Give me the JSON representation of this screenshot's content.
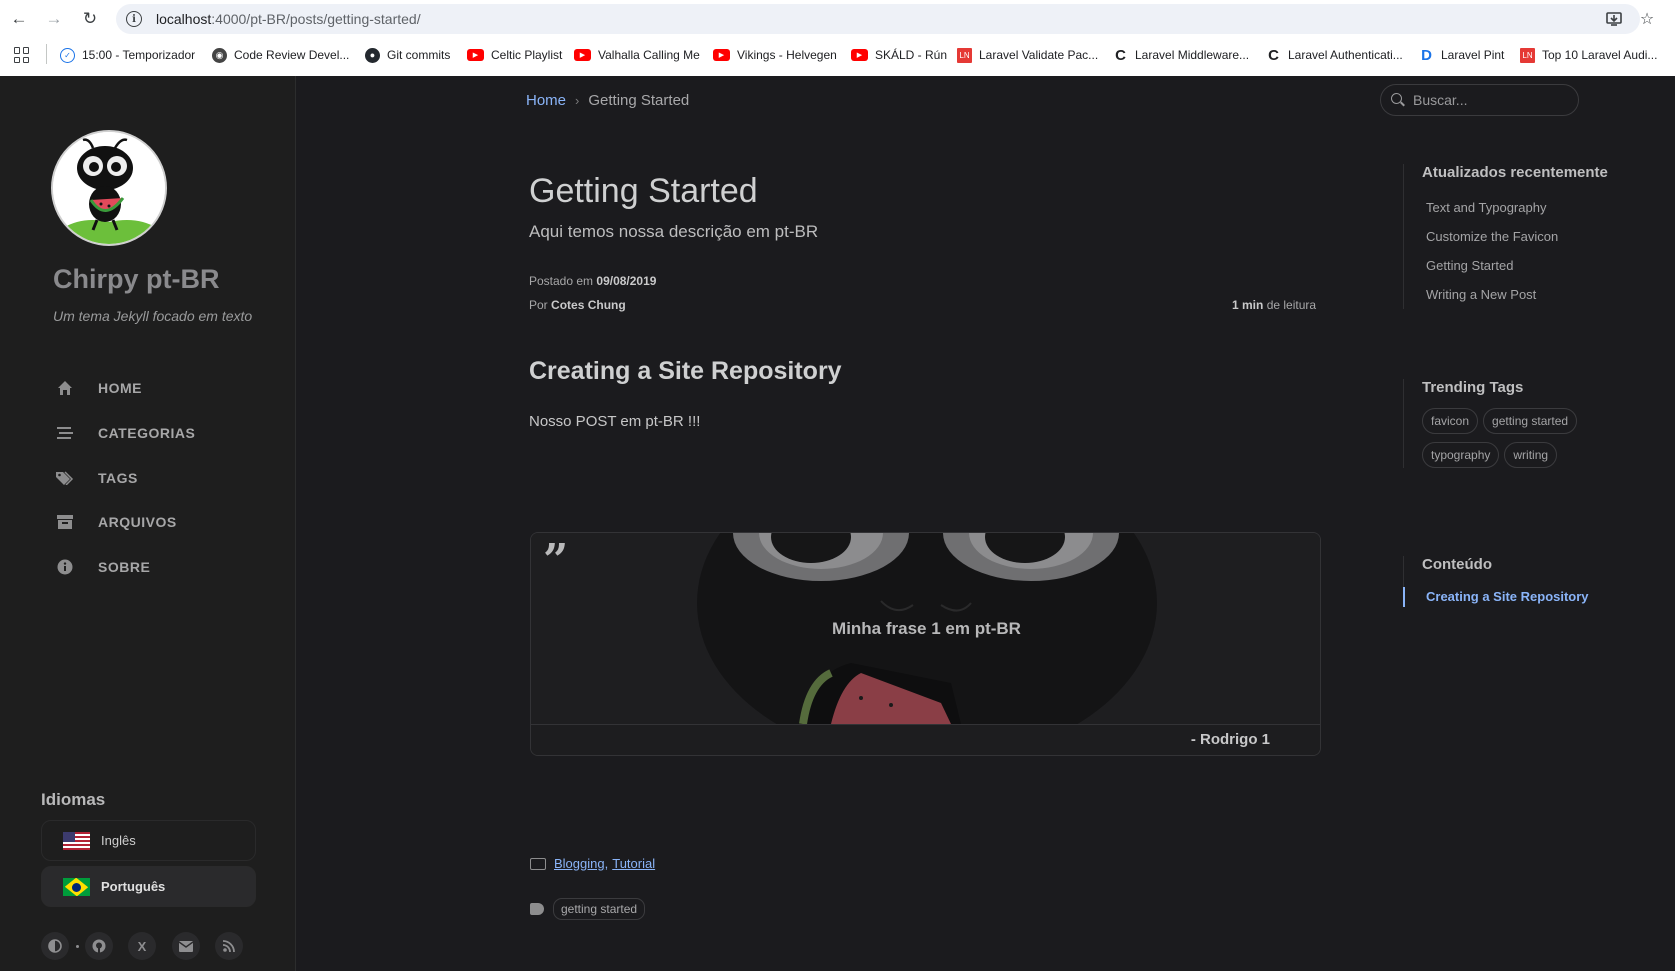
{
  "browser": {
    "url_host": "localhost",
    "url_rest": ":4000/pt-BR/posts/getting-started/",
    "bookmarks": [
      {
        "label": "15:00 - Temporizador",
        "icon": "clock-icon"
      },
      {
        "label": "Code Review Devel...",
        "icon": "code-review-icon"
      },
      {
        "label": "Git commits",
        "icon": "github-icon"
      },
      {
        "label": "Celtic Playlist",
        "icon": "youtube-icon"
      },
      {
        "label": "Valhalla Calling Me",
        "icon": "youtube-icon"
      },
      {
        "label": "Vikings - Helvegen",
        "icon": "youtube-icon"
      },
      {
        "label": "SKÁLD - Rún",
        "icon": "youtube-icon"
      },
      {
        "label": "Laravel Validate Pac...",
        "icon": "laravel-news-icon"
      },
      {
        "label": "Laravel Middleware...",
        "icon": "c-icon"
      },
      {
        "label": "Laravel Authenticati...",
        "icon": "c-icon"
      },
      {
        "label": "Laravel Pint",
        "icon": "pint-icon"
      },
      {
        "label": "Top 10 Laravel Audi...",
        "icon": "laravel-news-icon"
      }
    ]
  },
  "sidebar": {
    "title": "Chirpy pt-BR",
    "subtitle": "Um tema Jekyll focado em texto",
    "nav": [
      {
        "label": "HOME",
        "icon": "home-icon"
      },
      {
        "label": "CATEGORIAS",
        "icon": "stream-icon"
      },
      {
        "label": "TAGS",
        "icon": "tags-icon"
      },
      {
        "label": "ARQUIVOS",
        "icon": "archive-icon"
      },
      {
        "label": "SOBRE",
        "icon": "info-icon"
      }
    ],
    "languages_title": "Idiomas",
    "languages": [
      {
        "label": "Inglês",
        "active": false
      },
      {
        "label": "Português",
        "active": true
      }
    ]
  },
  "topbar": {
    "breadcrumb_home": "Home",
    "breadcrumb_current": "Getting Started",
    "search_placeholder": "Buscar..."
  },
  "post": {
    "title": "Getting Started",
    "description": "Aqui temos nossa descrição em pt-BR",
    "posted_label": "Postado em",
    "date": "09/08/2019",
    "by_label": "Por",
    "author": "Cotes Chung",
    "read_time": "1 min",
    "read_label": "de leitura",
    "heading": "Creating a Site Repository",
    "paragraph": "Nosso POST em pt-BR !!!",
    "quote_mark": "”",
    "quote_text": "Minha frase 1 em pt-BR",
    "quote_author": "- Rodrigo 1",
    "categories": [
      "Blogging",
      "Tutorial"
    ],
    "tags": [
      "getting started"
    ]
  },
  "panel": {
    "recent_title": "Atualizados recentemente",
    "recent": [
      "Text and Typography",
      "Customize the Favicon",
      "Getting Started",
      "Writing a New Post"
    ],
    "trending_title": "Trending Tags",
    "trending": [
      "favicon",
      "getting started",
      "typography",
      "writing"
    ],
    "toc_title": "Conteúdo",
    "toc": [
      "Creating a Site Repository"
    ]
  },
  "colors": {
    "background": "#1b1b1e",
    "sidebar": "#1e1e1e",
    "link": "#8ab4f8"
  }
}
